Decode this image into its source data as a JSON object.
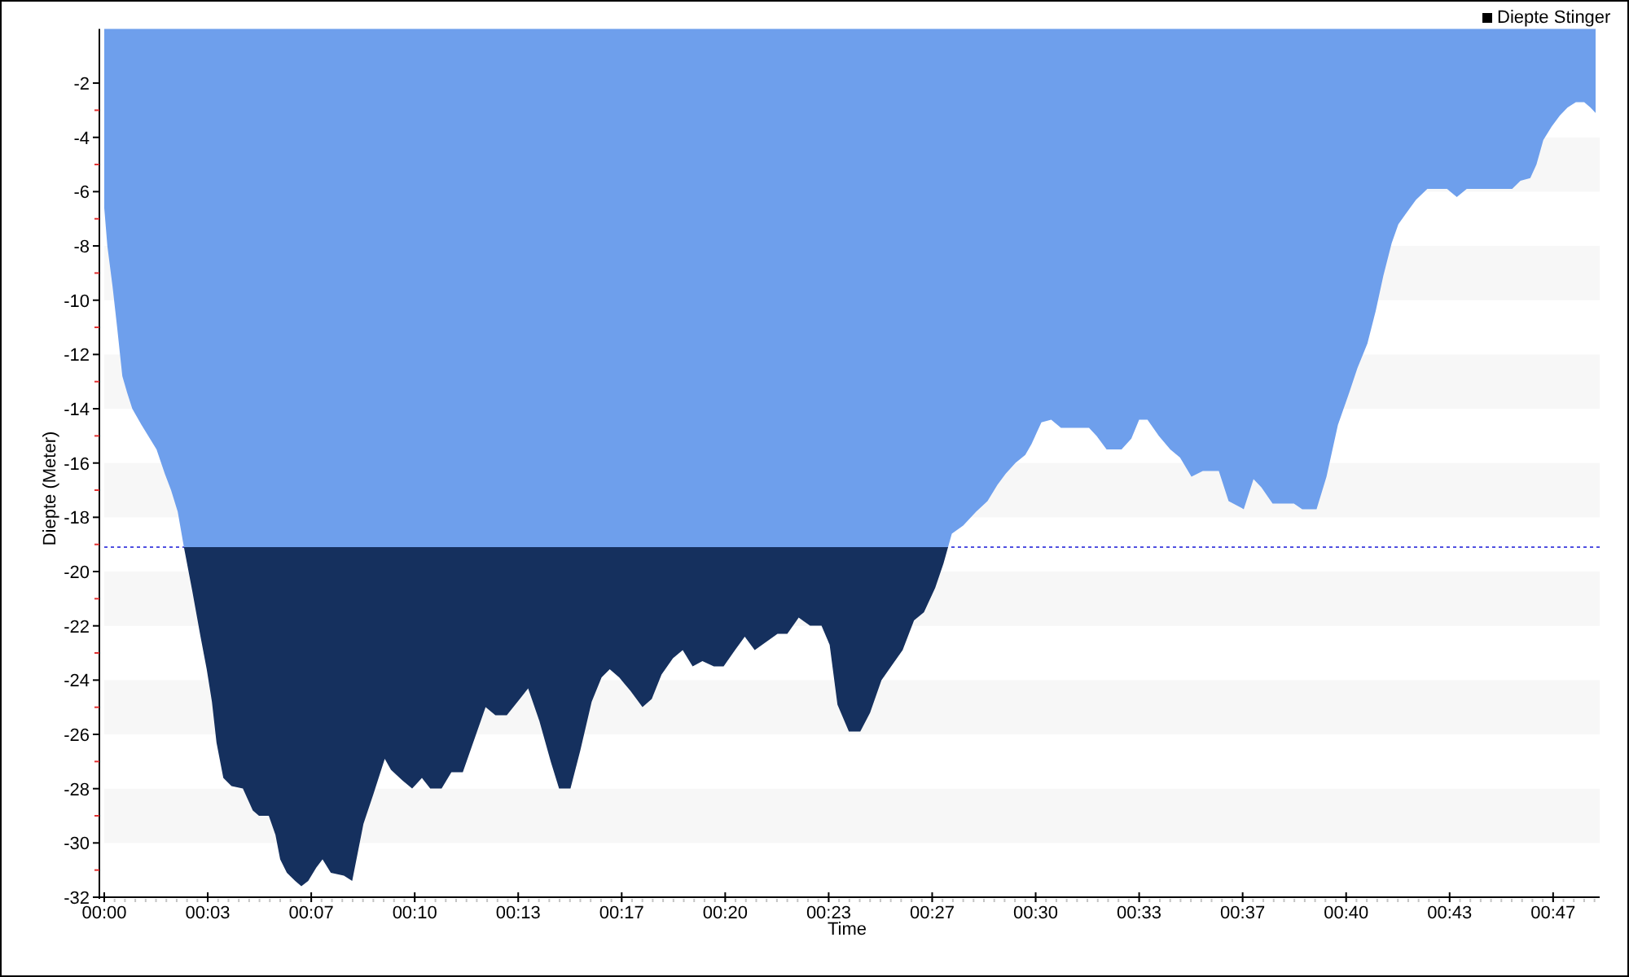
{
  "chart": {
    "chart_data": {
      "type": "area",
      "xlabel": "Time",
      "ylabel": "Diepte (Meter)",
      "x": [
        0,
        6,
        16,
        25,
        35,
        44,
        54,
        72,
        101,
        117,
        129,
        142,
        154,
        170,
        186,
        198,
        208,
        217,
        230,
        246,
        268,
        287,
        299,
        318,
        331,
        340,
        353,
        369,
        381,
        394,
        410,
        422,
        438,
        463,
        479,
        501,
        520,
        542,
        554,
        576,
        595,
        614,
        630,
        652,
        671,
        693,
        715,
        737,
        756,
        778,
        803,
        819,
        841,
        863,
        879,
        901,
        920,
        942,
        961,
        977,
        995,
        1017,
        1040,
        1058,
        1077,
        1099,
        1118,
        1137,
        1156,
        1178,
        1197,
        1219,
        1238,
        1257,
        1279,
        1301,
        1320,
        1342,
        1364,
        1386,
        1402,
        1417,
        1439,
        1461,
        1480,
        1502,
        1524,
        1543,
        1565,
        1584,
        1606,
        1622,
        1638,
        1660,
        1685,
        1707,
        1726,
        1742,
        1761,
        1780,
        1792,
        1811,
        1830,
        1849,
        1903,
        1918,
        1937,
        1966,
        1985,
        2000,
        2016,
        2038,
        2060,
        2079,
        2101,
        2123,
        2154,
        2173,
        2202,
        2221,
        2236,
        2258,
        2299,
        2315,
        2343,
        2362,
        2384,
        2406,
        2422,
        2441,
        2457,
        2472,
        2488,
        2501,
        2516,
        2535,
        2557,
        2595,
        2614,
        2633,
        2721,
        2737,
        2756,
        2768,
        2781,
        2797,
        2813,
        2828,
        2844,
        2860,
        2872,
        2882
      ],
      "series": [
        {
          "name": "Diepte Stinger",
          "color": "#6e9fec",
          "values": [
            -6.6,
            -8.0,
            -9.5,
            -11.0,
            -12.8,
            -13.4,
            -14.0,
            -14.6,
            -15.5,
            -16.4,
            -17.0,
            -17.8,
            -19.1,
            -20.7,
            -22.4,
            -23.6,
            -24.8,
            -26.3,
            -27.6,
            -27.9,
            -28.0,
            -28.8,
            -29.0,
            -29.0,
            -29.7,
            -30.6,
            -31.1,
            -31.4,
            -31.6,
            -31.4,
            -30.9,
            -30.6,
            -31.1,
            -31.2,
            -31.4,
            -29.3,
            -28.2,
            -26.9,
            -27.3,
            -27.7,
            -28.0,
            -27.6,
            -28.0,
            -28.0,
            -27.4,
            -27.4,
            -26.2,
            -25.0,
            -25.3,
            -25.3,
            -24.7,
            -24.3,
            -25.5,
            -27.0,
            -28.0,
            -28.0,
            -26.6,
            -24.8,
            -23.9,
            -23.6,
            -23.9,
            -24.4,
            -25.0,
            -24.7,
            -23.8,
            -23.2,
            -22.9,
            -23.5,
            -23.3,
            -23.5,
            -23.5,
            -22.9,
            -22.4,
            -22.9,
            -22.6,
            -22.3,
            -22.3,
            -21.7,
            -22.0,
            -22.0,
            -22.7,
            -24.9,
            -25.9,
            -25.9,
            -25.2,
            -24.0,
            -23.4,
            -22.9,
            -21.8,
            -21.5,
            -20.6,
            -19.7,
            -18.6,
            -18.3,
            -17.8,
            -17.4,
            -16.8,
            -16.4,
            -16.0,
            -15.7,
            -15.3,
            -14.5,
            -14.4,
            -14.7,
            -14.7,
            -15.0,
            -15.5,
            -15.5,
            -15.1,
            -14.4,
            -14.4,
            -15.0,
            -15.5,
            -15.8,
            -16.5,
            -16.3,
            -16.3,
            -17.4,
            -17.7,
            -16.6,
            -16.9,
            -17.5,
            -17.5,
            -17.7,
            -17.7,
            -16.5,
            -14.6,
            -13.4,
            -12.5,
            -11.6,
            -10.4,
            -9.1,
            -7.9,
            -7.2,
            -6.8,
            -6.3,
            -5.9,
            -5.9,
            -6.2,
            -5.9,
            -5.9,
            -5.6,
            -5.5,
            -5.0,
            -4.1,
            -3.6,
            -3.2,
            -2.9,
            -2.7,
            -2.7,
            -2.9,
            -3.1
          ]
        }
      ],
      "xlim": [
        0,
        2890
      ],
      "ylim": [
        -32,
        0
      ],
      "xticks": [
        {
          "value": 0,
          "label": "00:00"
        },
        {
          "value": 200,
          "label": "00:03"
        },
        {
          "value": 400,
          "label": "00:07"
        },
        {
          "value": 600,
          "label": "00:10"
        },
        {
          "value": 800,
          "label": "00:13"
        },
        {
          "value": 1000,
          "label": "00:17"
        },
        {
          "value": 1200,
          "label": "00:20"
        },
        {
          "value": 1400,
          "label": "00:23"
        },
        {
          "value": 1600,
          "label": "00:27"
        },
        {
          "value": 1800,
          "label": "00:30"
        },
        {
          "value": 2000,
          "label": "00:33"
        },
        {
          "value": 2200,
          "label": "00:37"
        },
        {
          "value": 2400,
          "label": "00:40"
        },
        {
          "value": 2600,
          "label": "00:43"
        },
        {
          "value": 2800,
          "label": "00:47"
        }
      ],
      "yticks": [
        -2,
        -4,
        -6,
        -8,
        -10,
        -12,
        -14,
        -16,
        -18,
        -20,
        -22,
        -24,
        -26,
        -28,
        -30,
        -32
      ],
      "ref_lines": [
        {
          "axis": "y",
          "value": -19.1,
          "color": "#5050e0"
        }
      ]
    }
  }
}
